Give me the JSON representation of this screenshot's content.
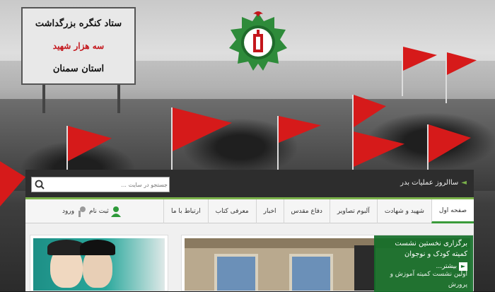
{
  "billboard": {
    "line1": "ستاد کنگره بزرگداشت",
    "line2": "سه هزار شهید",
    "line3": "استان سمنان"
  },
  "header": {
    "site_name": "ساالروز عملیات بدر",
    "search": {
      "placeholder": "جستجو در سایت ..."
    }
  },
  "menu": {
    "items": [
      {
        "label": "صفحه اول"
      },
      {
        "label": "شهید و شهادت"
      },
      {
        "label": "آلبوم تصاویر"
      },
      {
        "label": "دفاع مقدس"
      },
      {
        "label": "اخبار"
      },
      {
        "label": "معرفی کتاب"
      },
      {
        "label": "ارتباط با ما"
      }
    ]
  },
  "account": {
    "register_label": "ثبت نام",
    "login_label": "ورود"
  },
  "featured": {
    "title": "برگزاری نخستین نشست کمیته کودک و نوجوان",
    "more_label": "بیشتر...",
    "next_title": "اولین نشست کمیته آموزش و پرورش"
  },
  "colors": {
    "accent_green": "#3a9a3a",
    "flag_red": "#d61a1a"
  }
}
